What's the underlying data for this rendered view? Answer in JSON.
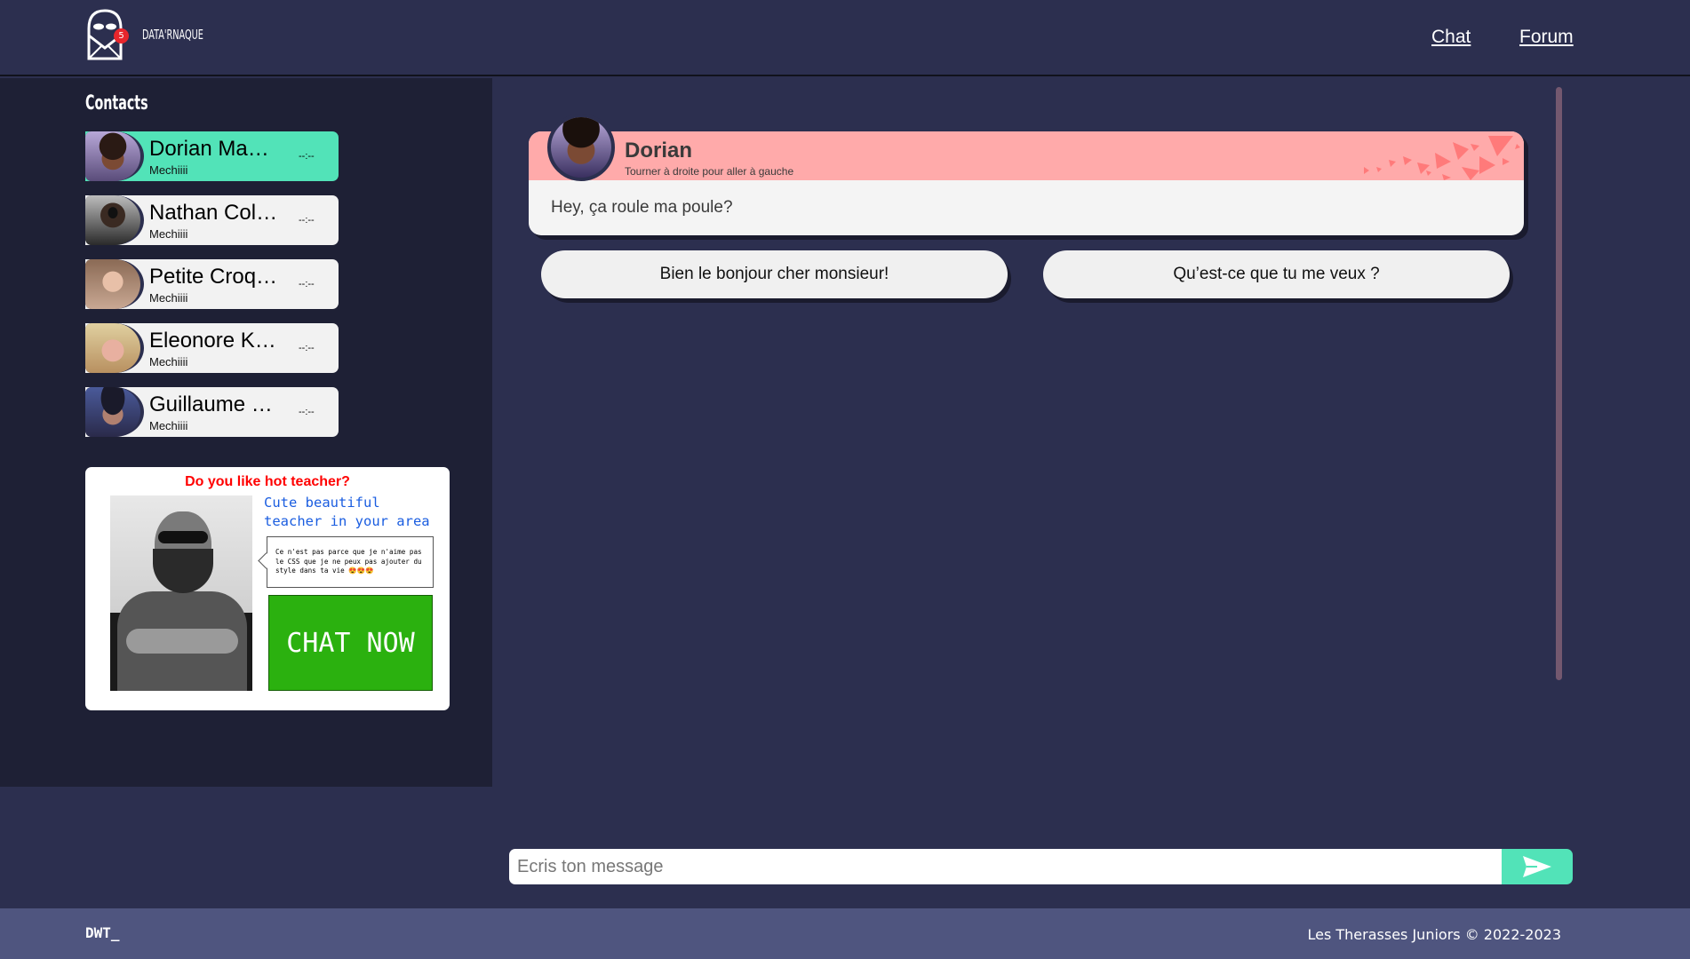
{
  "header": {
    "brand": "DATA'RNAQUE",
    "notification_count": "5",
    "nav": [
      {
        "label": "Chat"
      },
      {
        "label": "Forum"
      }
    ]
  },
  "sidebar": {
    "title": "Contacts",
    "contacts": [
      {
        "name": "Dorian Ma…",
        "subtitle": "Mechiiii",
        "time": "--:--",
        "active": true
      },
      {
        "name": "Nathan Col…",
        "subtitle": "Mechiiii",
        "time": "--:--",
        "active": false
      },
      {
        "name": "Petite Croq…",
        "subtitle": "Mechiiii",
        "time": "--:--",
        "active": false
      },
      {
        "name": "Eleonore K…",
        "subtitle": "Mechiiii",
        "time": "--:--",
        "active": false
      },
      {
        "name": "Guillaume …",
        "subtitle": "Mechiiii",
        "time": "--:--",
        "active": false
      }
    ]
  },
  "ad": {
    "title": "Do you like hot teacher?",
    "tagline_line1": "Cute beautiful",
    "tagline_line2": "teacher in your area",
    "bubble": "Ce n'est pas parce que je n'aime pas le CSS que je ne peux pas ajouter du style dans ta vie 😍😍😍",
    "cta": "CHAT NOW"
  },
  "conversation": {
    "sender": "Dorian",
    "sender_status": "Tourner à droite pour aller à gauche",
    "message": "Hey, ça roule ma poule?",
    "replies": [
      {
        "label": "Bien le bonjour cher monsieur!"
      },
      {
        "label": "Qu’est-ce que tu me veux ?"
      }
    ]
  },
  "composer": {
    "placeholder": "Ecris ton message",
    "value": ""
  },
  "footer": {
    "left": "DWT_",
    "right": "Les Therasses Juniors © 2022-2023"
  },
  "colors": {
    "background": "#2c2f4f",
    "sidebar": "#1e2035",
    "accent": "#52e3b8",
    "message_header": "#ffaaaa",
    "footer": "#4f557f",
    "badge": "#e8262c"
  }
}
